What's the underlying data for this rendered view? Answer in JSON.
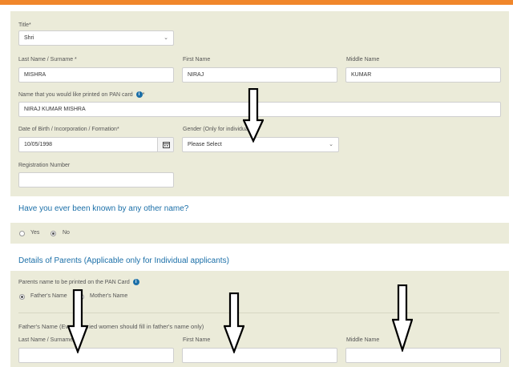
{
  "form": {
    "title_label": "Title*",
    "title_value": "Shri",
    "last_name_label": "Last Name / Surname *",
    "last_name_value": "MISHRA",
    "first_name_label": "First Name",
    "first_name_value": "NIRAJ",
    "middle_name_label": "Middle Name",
    "middle_name_value": "KUMAR",
    "pan_name_label": "Name that you would like printed on PAN card",
    "pan_name_star": "*",
    "pan_name_value": "NIRAJ KUMAR MISHRA",
    "dob_label": "Date of Birth / Incorporation / Formation*",
    "dob_value": "10/05/1998",
    "gender_label": "Gender (Only for individuals)",
    "gender_value": "Please Select",
    "reg_label": "Registration Number",
    "reg_value": ""
  },
  "other_name": {
    "question": "Have you ever been known by any other name?",
    "options": [
      "Yes",
      "No"
    ],
    "selected": "No"
  },
  "parents": {
    "section_title": "Details of Parents (Applicable only for Individual applicants)",
    "print_label": "Parents name to be printed on the PAN Card",
    "options": [
      "Father's Name",
      "Mother's Name"
    ],
    "selected": "Father's Name",
    "father_heading": "Father's Name (Even married women should fill in father's name only)",
    "last_name_label": "Last Name / Surname *",
    "first_name_label": "First Name",
    "middle_name_label": "Middle Name"
  },
  "icons": {
    "info": "info-icon",
    "calendar": "calendar-icon",
    "chevron": "chevron-down-icon",
    "annotation": "down-arrow-annotation"
  },
  "colors": {
    "topbar": "#f0862b",
    "panel": "#ebebd9",
    "section_title": "#1b6fa8",
    "info_icon": "#1b6fa8"
  }
}
